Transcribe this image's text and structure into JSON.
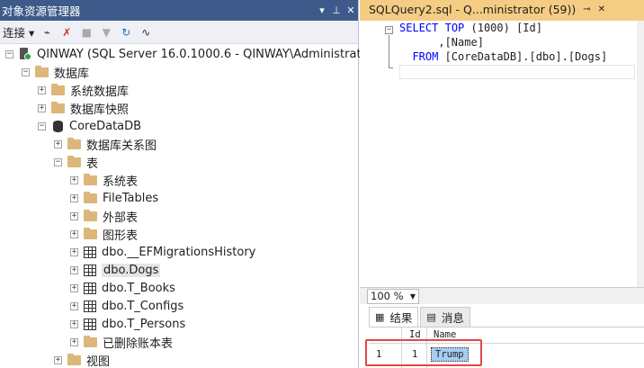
{
  "object_explorer": {
    "title": "对象资源管理器",
    "connect_label": "连接",
    "pin_controls": [
      "▾",
      "📌",
      "✕"
    ],
    "tree": [
      {
        "label": "QINWAY (SQL Server 16.0.1000.6 - QINWAY\\Administrator)",
        "icon": "server-icon",
        "level": 0,
        "expanded": true
      },
      {
        "label": "数据库",
        "icon": "folder-icon",
        "level": 1,
        "expanded": true
      },
      {
        "label": "系统数据库",
        "icon": "folder-icon",
        "level": 2,
        "expanded": false
      },
      {
        "label": "数据库快照",
        "icon": "folder-icon",
        "level": 2,
        "expanded": false
      },
      {
        "label": "CoreDataDB",
        "icon": "database-icon",
        "level": 2,
        "expanded": true
      },
      {
        "label": "数据库关系图",
        "icon": "folder-icon",
        "level": 3,
        "expanded": false
      },
      {
        "label": "表",
        "icon": "folder-icon",
        "level": 3,
        "expanded": true
      },
      {
        "label": "系统表",
        "icon": "folder-icon",
        "level": 4,
        "expanded": false
      },
      {
        "label": "FileTables",
        "icon": "folder-icon",
        "level": 4,
        "expanded": false
      },
      {
        "label": "外部表",
        "icon": "folder-icon",
        "level": 4,
        "expanded": false
      },
      {
        "label": "图形表",
        "icon": "folder-icon",
        "level": 4,
        "expanded": false
      },
      {
        "label": "dbo.__EFMigrationsHistory",
        "icon": "table-icon",
        "level": 4,
        "expanded": false
      },
      {
        "label": "dbo.Dogs",
        "icon": "table-icon",
        "level": 4,
        "expanded": false,
        "selected": true
      },
      {
        "label": "dbo.T_Books",
        "icon": "table-icon",
        "level": 4,
        "expanded": false
      },
      {
        "label": "dbo.T_Configs",
        "icon": "table-icon",
        "level": 4,
        "expanded": false
      },
      {
        "label": "dbo.T_Persons",
        "icon": "table-icon",
        "level": 4,
        "expanded": false
      },
      {
        "label": "已删除账本表",
        "icon": "folder-icon",
        "level": 4,
        "expanded": false
      },
      {
        "label": "视图",
        "icon": "folder-icon",
        "level": 3,
        "expanded": false
      }
    ]
  },
  "query_tab": {
    "title": "SQLQuery2.sql - Q...ministrator (59))",
    "pin": "⊸",
    "close": "✕"
  },
  "sql": {
    "line1_kw1": "SELECT",
    "line1_kw2": "TOP",
    "line1_rest": " (1000) [Id]",
    "line2": "      ,[Name]",
    "line3_kw": "FROM",
    "line3_rest": " [CoreDataDB].[dbo].[Dogs]"
  },
  "zoom": "100 %",
  "results_tabs": {
    "results": "结果",
    "messages": "消息"
  },
  "grid": {
    "columns": [
      "Id",
      "Name"
    ],
    "rows": [
      {
        "row_num": "1",
        "Id": "1",
        "Name": "Trump"
      }
    ]
  }
}
